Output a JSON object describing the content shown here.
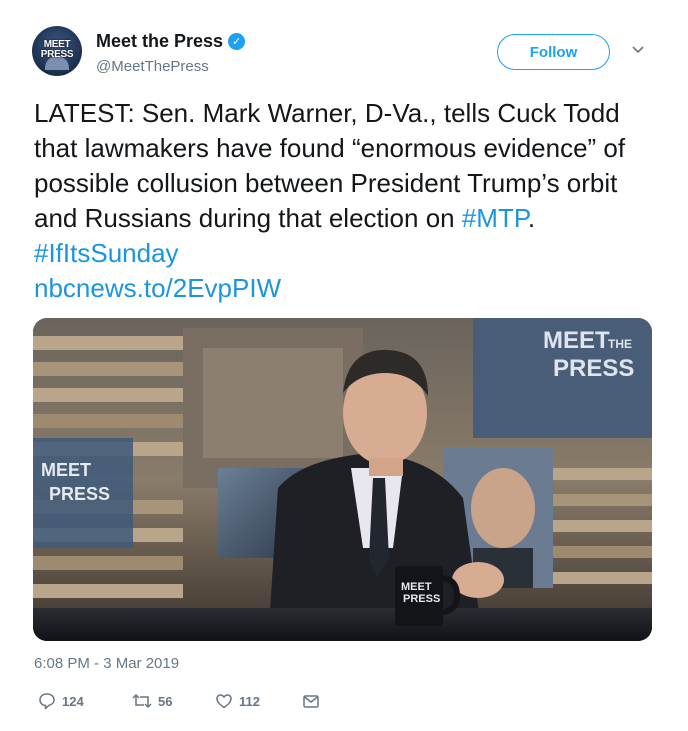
{
  "account": {
    "display_name": "Meet the Press",
    "handle": "@MeetThePress",
    "avatar_text_line1": "MEET",
    "avatar_text_line2": "PRESS"
  },
  "follow_label": "Follow",
  "tweet": {
    "text": "LATEST: Sen. Mark Warner, D-Va., tells Cuck Todd that lawmakers have found “enormous evidence” of possible collusion between President Trump’s orbit and Russians during that election on ",
    "hashtag1": "#MTP",
    "between": ". ",
    "hashtag2": "#IfItsSunday",
    "link": "nbcnews.to/2EvpPIW"
  },
  "media": {
    "logo_topright_line1": "MEET",
    "logo_topright_line2": "THE",
    "logo_topright_line3": "PRESS",
    "logo_left_line1": "MEET",
    "logo_left_line2": "PRESS",
    "logo_mug_line1": "MEET",
    "logo_mug_line2": "PRESS"
  },
  "timestamp": "6:08 PM - 3 Mar 2019",
  "actions": {
    "replies": "124",
    "retweets": "56",
    "likes": "112"
  },
  "colors": {
    "accent": "#1da1f2",
    "link": "#1b95e0",
    "secondary_text": "#657786"
  }
}
